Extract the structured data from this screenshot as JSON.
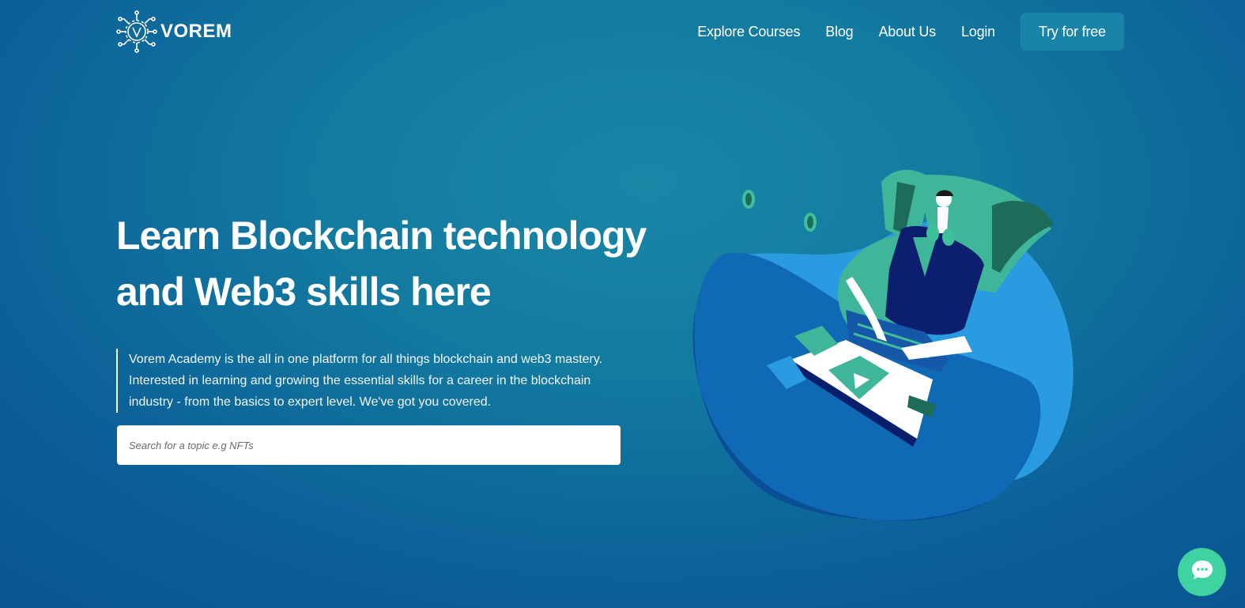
{
  "brand": {
    "name": "VOREM",
    "logo_icon": "circuit-v-logo"
  },
  "nav": {
    "links": [
      "Explore Courses",
      "Blog",
      "About Us",
      "Login"
    ],
    "cta_label": "Try for free"
  },
  "hero": {
    "title_line1": "Learn Blockchain technology",
    "title_line2": "and Web3 skills here",
    "description": "Vorem Academy is the all in one platform for all things blockchain and web3 mastery. Interested in learning and growing the essential skills for a career in the blockchain industry - from the basics to expert level. We've got you covered.",
    "search_placeholder": "Search for a topic e.g NFTs",
    "illustration": "person-on-beanbag-with-laptop"
  },
  "chat": {
    "icon": "chat-bubble-icon"
  },
  "colors": {
    "background": "#137aa0",
    "cta": "#1a84a8",
    "accent_green": "#3ed3a0",
    "beanbag_dark": "#0f69b4",
    "beanbag_light": "#2a9be0"
  }
}
